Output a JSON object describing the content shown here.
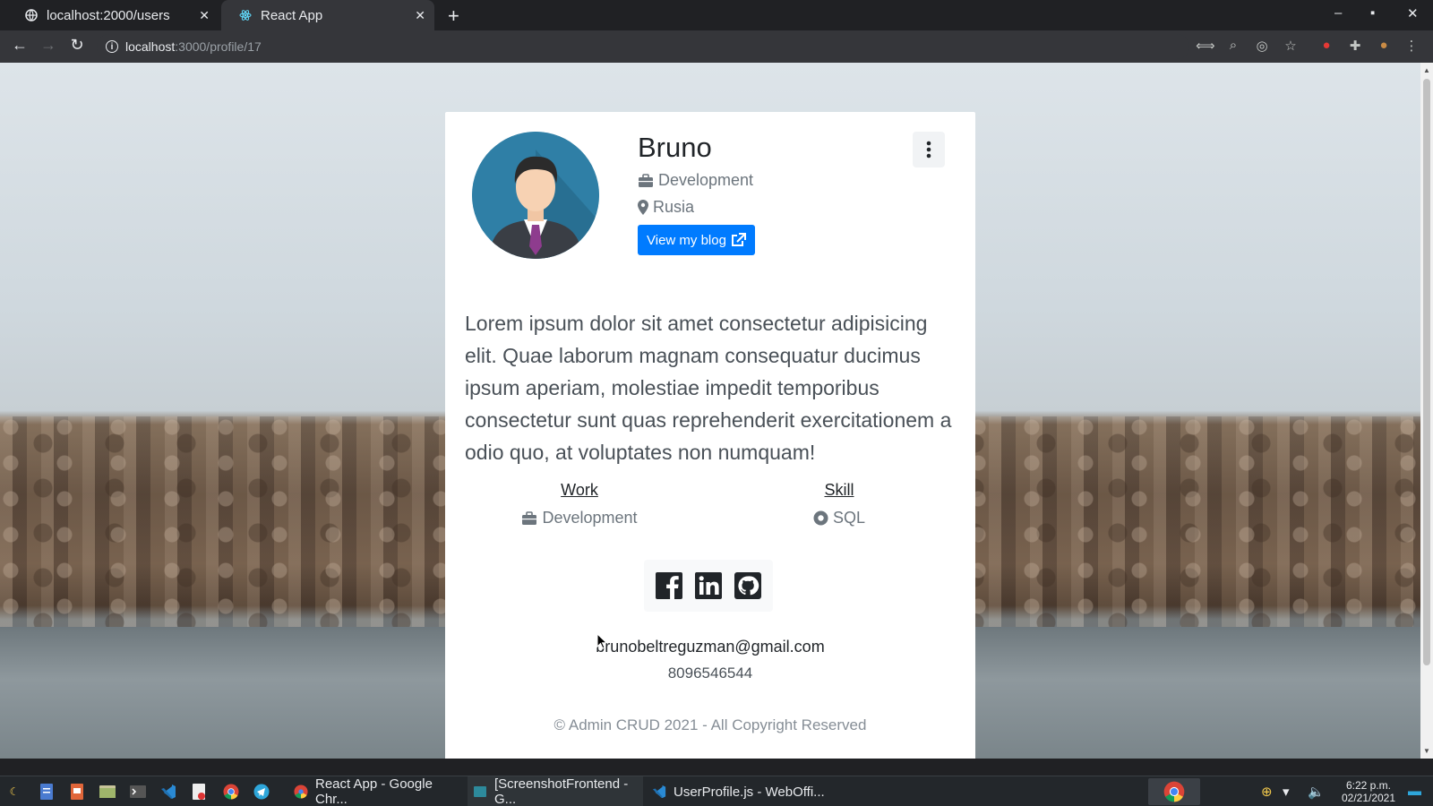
{
  "browser": {
    "tabs": [
      {
        "title": "localhost:2000/users",
        "active": false,
        "icon": "globe-icon"
      },
      {
        "title": "React App",
        "active": true,
        "icon": "react-icon"
      }
    ],
    "url_host": "localhost",
    "url_path": ":3000/profile/17"
  },
  "profile": {
    "name": "Bruno",
    "department": "Development",
    "location": "Rusia",
    "blog_button": "View my blog",
    "bio": "Lorem ipsum dolor sit amet consectetur adipisicing elit. Quae laborum magnam consequatur ducimus ipsum aperiam, molestiae impedit temporibus consectetur sunt quas reprehenderit exercitationem a odio quo, at voluptates non numquam!",
    "work_heading": "Work",
    "work_value": "Development",
    "skill_heading": "Skill",
    "skill_value": "SQL",
    "social": [
      "facebook-icon",
      "linkedin-icon",
      "github-icon"
    ],
    "email": "brunobeltreguzman@gmail.com",
    "phone": "8096546544",
    "footer": "© Admin CRUD 2021 - All Copyright Reserved"
  },
  "taskbar": {
    "apps": [
      {
        "label": "React App - Google Chr...",
        "icon": "chrome-icon"
      },
      {
        "label": "[ScreenshotFrontend - G...",
        "icon": "window-icon"
      },
      {
        "label": "UserProfile.js - WebOffi...",
        "icon": "vscode-icon"
      }
    ],
    "time": "6:22 p.m.",
    "date": "02/21/2021"
  },
  "colors": {
    "primary": "#007bff",
    "card_bg": "#ffffff",
    "chrome_dark": "#202124"
  }
}
